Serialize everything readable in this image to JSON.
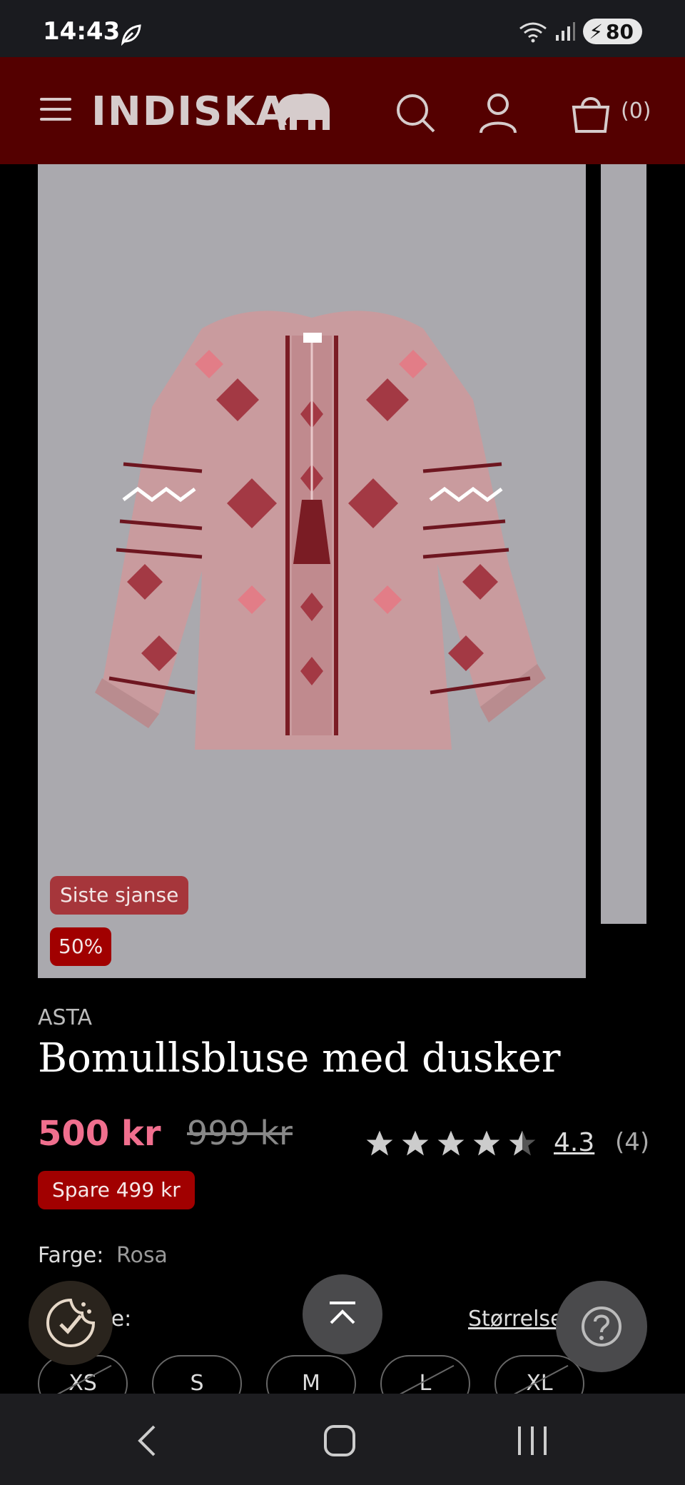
{
  "status": {
    "time": "14:43",
    "battery": "80"
  },
  "header": {
    "brand": "INDISKA",
    "cart_count": "(0)"
  },
  "product": {
    "badges": {
      "last_chance": "Siste sjanse",
      "discount": "50%"
    },
    "brand": "ASTA",
    "title": "Bomullsbluse med dusker",
    "price": "500 kr",
    "old_price": "999 kr",
    "saving": "Spare 499 kr",
    "rating": {
      "value": 4.3,
      "display": "4.3",
      "count": "(4)",
      "stars_filled": 4.3,
      "stars_total": 5
    },
    "color": {
      "label": "Farge:",
      "value": "Rosa"
    },
    "size": {
      "label_partial": "se:",
      "guide_label": "Størrelse",
      "options": [
        {
          "label": "XS",
          "available": false
        },
        {
          "label": "S",
          "available": true
        },
        {
          "label": "M",
          "available": true
        },
        {
          "label": "L",
          "available": false
        },
        {
          "label": "XL",
          "available": false
        }
      ]
    }
  },
  "colors": {
    "header_bg": "#540000",
    "price": "#f06f8e",
    "badge_discount": "#a10000",
    "badge_last": "#a6363b"
  },
  "icons": [
    "menu-icon",
    "elephant-logo-icon",
    "search-icon",
    "user-icon",
    "cart-icon",
    "cookie-consent-icon",
    "scroll-to-top-icon",
    "help-icon",
    "back-icon",
    "home-icon",
    "recents-icon"
  ]
}
